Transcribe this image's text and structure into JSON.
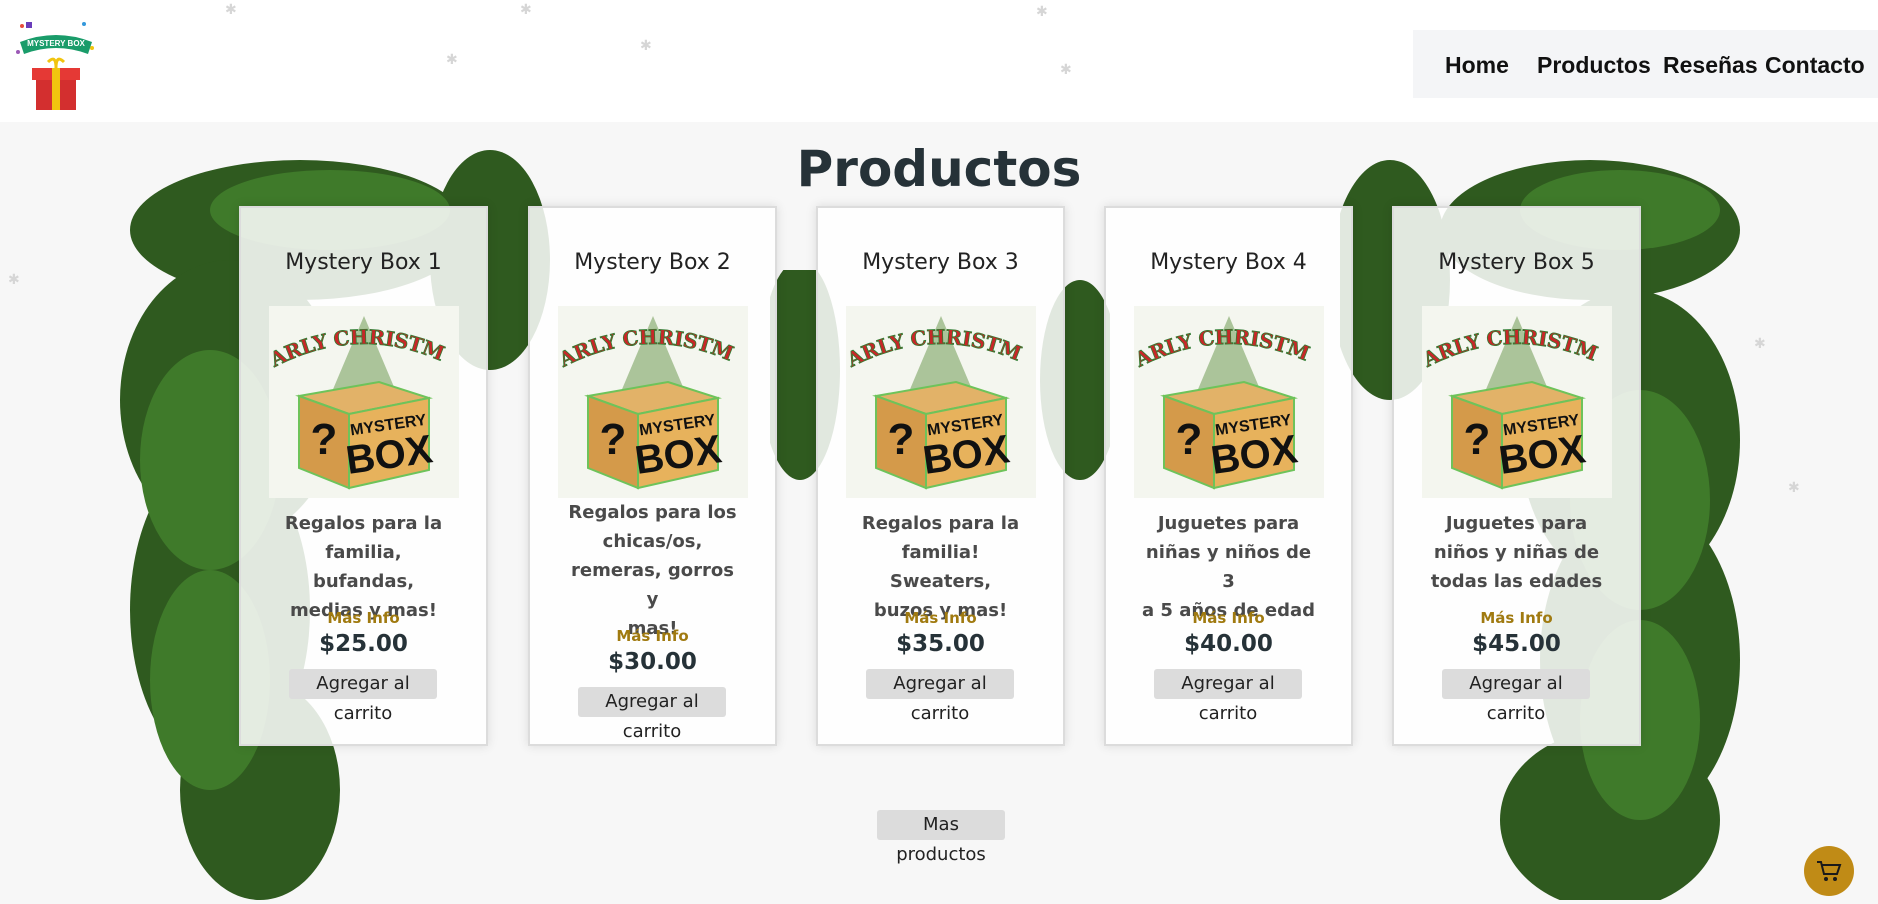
{
  "header": {
    "logo_text": "MYSTERY BOX",
    "nav": [
      "Home",
      "Productos",
      "Reseñas",
      "Contacto"
    ]
  },
  "section_title": "Productos",
  "box_image": {
    "banner": "EARLY CHRISTMAS",
    "box_top": "MYSTERY",
    "box_bottom": "BOX",
    "mark": "?"
  },
  "products": [
    {
      "name": "Mystery Box 1",
      "desc_lines": [
        "Regalos para la",
        "familia, bufandas,",
        "medias y mas!"
      ],
      "more": "Más Info",
      "price": "$25.00",
      "cta": "Agregar al carrito"
    },
    {
      "name": "Mystery Box 2",
      "desc_lines": [
        "Regalos para los",
        "chicas/os,",
        "remeras, gorros y",
        "mas!"
      ],
      "more": "Más Info",
      "price": "$30.00",
      "cta": "Agregar al carrito"
    },
    {
      "name": "Mystery Box 3",
      "desc_lines": [
        "Regalos para la",
        "familia! Sweaters,",
        "buzos y mas!"
      ],
      "more": "Más Info",
      "price": "$35.00",
      "cta": "Agregar al carrito"
    },
    {
      "name": "Mystery Box 4",
      "desc_lines": [
        "Juguetes para",
        "niñas y niños de 3",
        "a 5 años de edad"
      ],
      "more": "Más Info",
      "price": "$40.00",
      "cta": "Agregar al carrito"
    },
    {
      "name": "Mystery Box 5",
      "desc_lines": [
        "Juguetes para",
        "niños y niñas de",
        "todas las edades"
      ],
      "more": "Más Info",
      "price": "$45.00",
      "cta": "Agregar al carrito"
    }
  ],
  "more_products": "Mas productos",
  "cart_icon": "cart-icon",
  "colors": {
    "accent": "#c08b16",
    "more_info": "#a07a10",
    "title": "#263238"
  }
}
